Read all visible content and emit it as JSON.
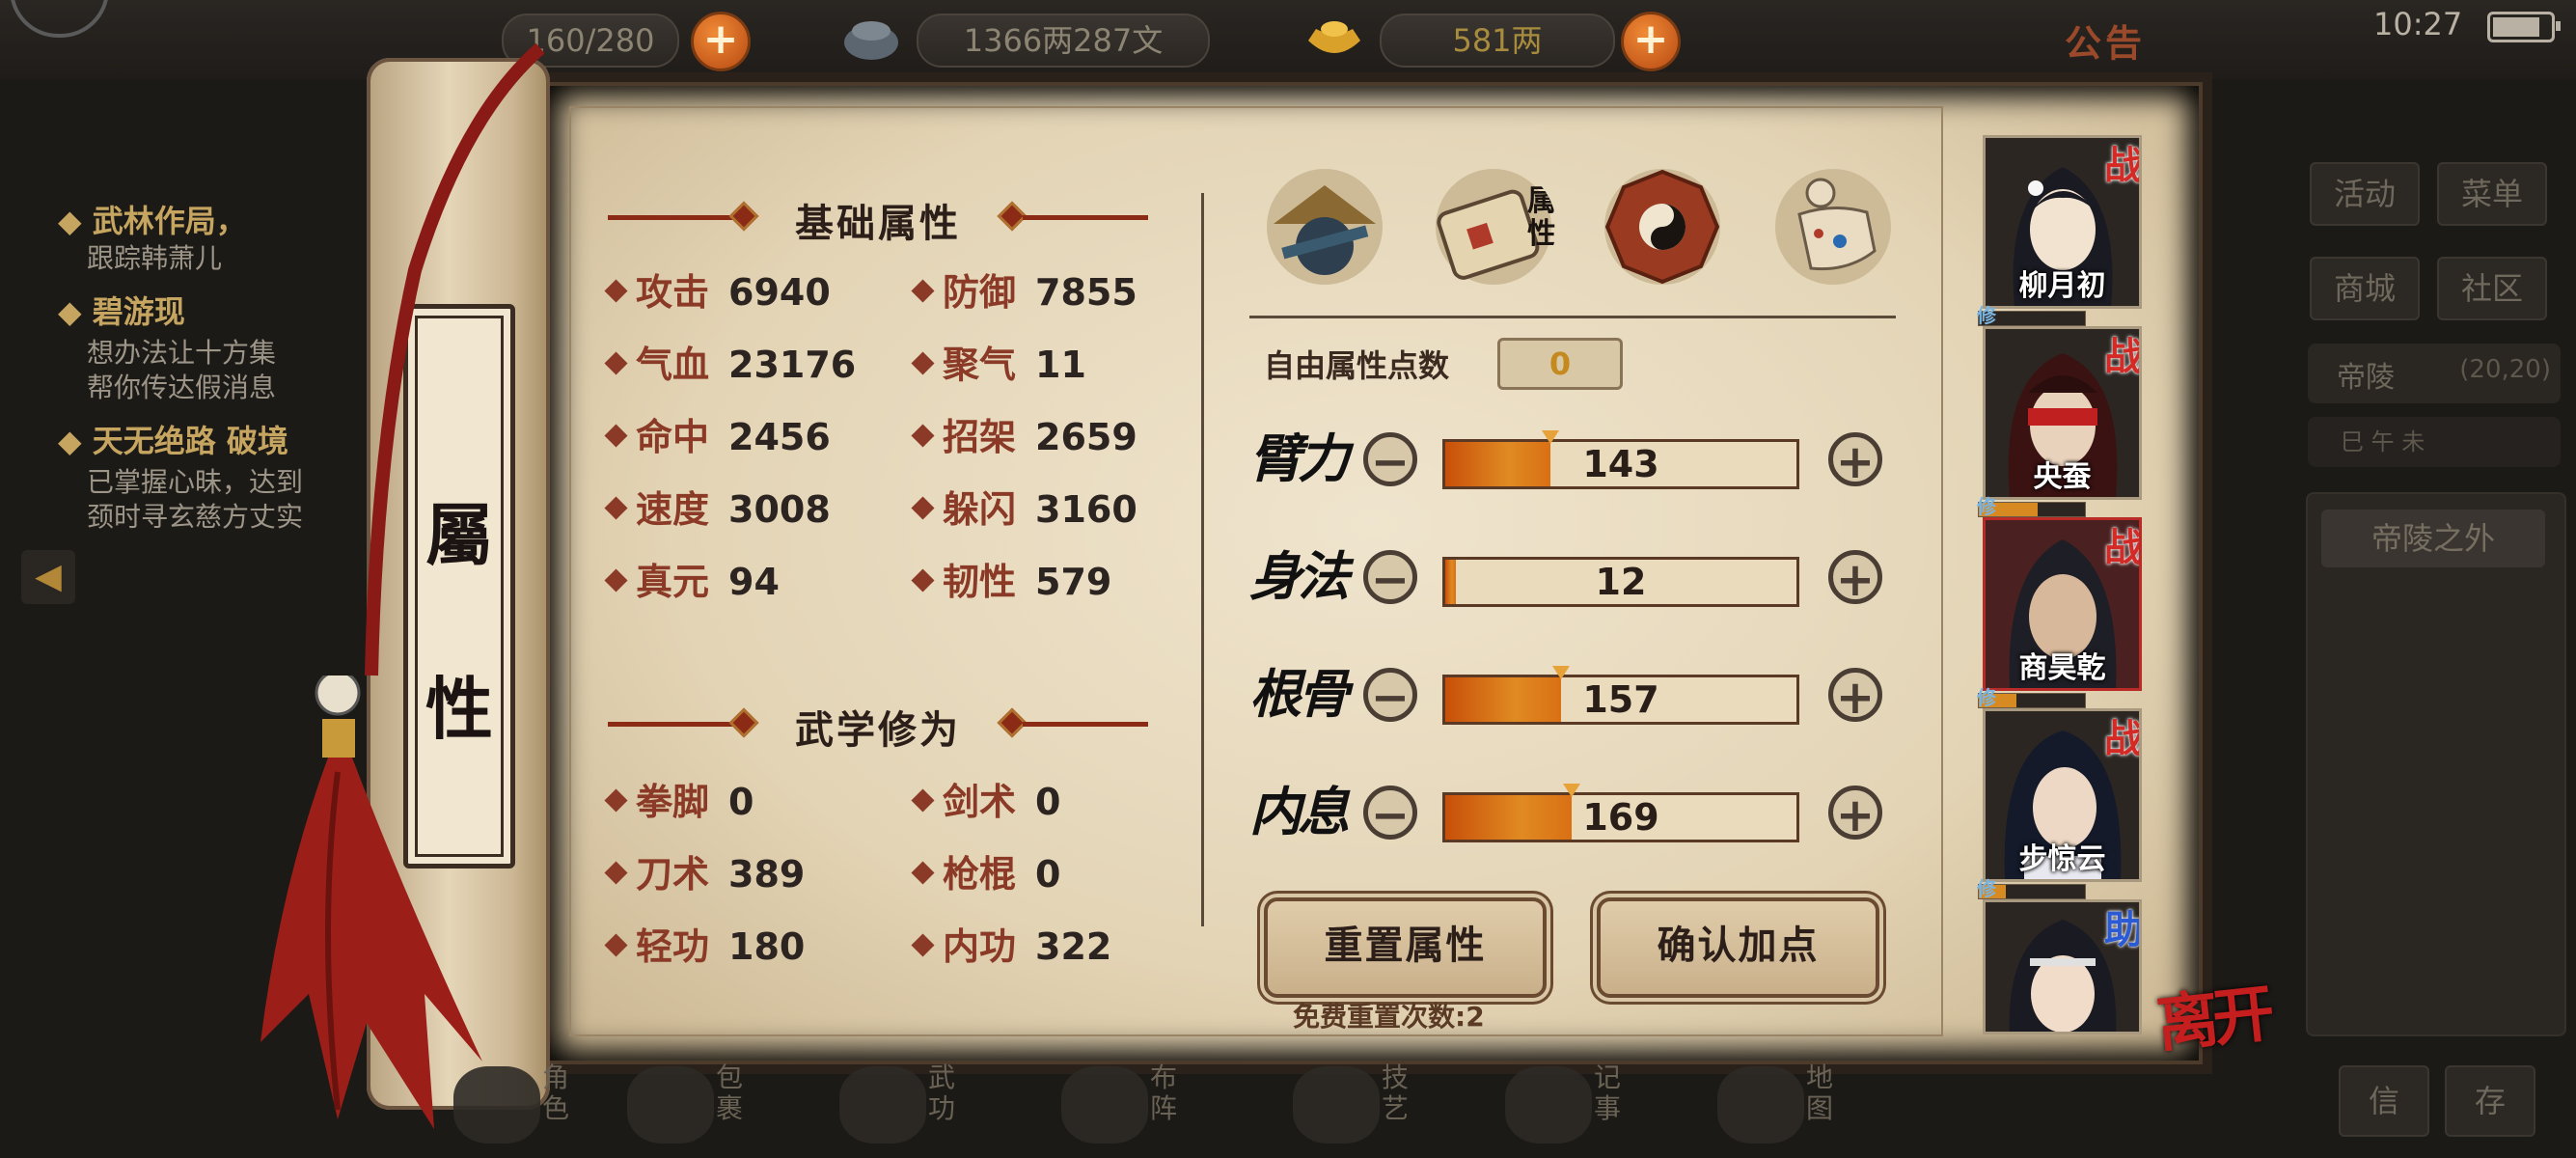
{
  "hud": {
    "stamina": "160/280",
    "money": "1366两287文",
    "gold": "581两",
    "notice": "公告",
    "time": "10:27",
    "battery_level": 0.85
  },
  "quests": [
    {
      "title": "武林作局，",
      "desc": "跟踪韩萧儿"
    },
    {
      "title": "碧游现",
      "desc": "想办法让十方集\n帮你传达假消息"
    },
    {
      "title": "天无绝路 破境",
      "desc": "已掌握心昧，达到\n颈时寻玄慈方丈实"
    }
  ],
  "scroll_tab": "屬\n性",
  "basic_section": "基础属性",
  "basic_stats": [
    {
      "label": "攻击",
      "value": "6940"
    },
    {
      "label": "防御",
      "value": "7855"
    },
    {
      "label": "气血",
      "value": "23176"
    },
    {
      "label": "聚气",
      "value": "11"
    },
    {
      "label": "命中",
      "value": "2456"
    },
    {
      "label": "招架",
      "value": "2659"
    },
    {
      "label": "速度",
      "value": "3008"
    },
    {
      "label": "躲闪",
      "value": "3160"
    },
    {
      "label": "真元",
      "value": "94"
    },
    {
      "label": "韧性",
      "value": "579"
    }
  ],
  "martial_section": "武学修为",
  "martial_stats": [
    {
      "label": "拳脚",
      "value": "0"
    },
    {
      "label": "剑术",
      "value": "0"
    },
    {
      "label": "刀术",
      "value": "389"
    },
    {
      "label": "枪棍",
      "value": "0"
    },
    {
      "label": "轻功",
      "value": "180"
    },
    {
      "label": "内功",
      "value": "322"
    }
  ],
  "tabs": {
    "selected_label": "属\n性"
  },
  "free_points": {
    "label": "自由属性点数",
    "value": "0"
  },
  "attributes": [
    {
      "name": "臂力",
      "value": "143",
      "fill": 0.3
    },
    {
      "name": "身法",
      "value": "12",
      "fill": 0.03
    },
    {
      "name": "根骨",
      "value": "157",
      "fill": 0.33
    },
    {
      "name": "内息",
      "value": "169",
      "fill": 0.36
    }
  ],
  "buttons": {
    "reset": "重置属性",
    "confirm": "确认加点",
    "minus": "−",
    "plus": "+"
  },
  "reset_count": "免费重置次数:2",
  "characters": [
    {
      "name": "柳月初",
      "badge": "战",
      "cult": 0.0
    },
    {
      "name": "央蚕",
      "badge": "战",
      "cult": 0.55
    },
    {
      "name": "商昊乾",
      "badge": "战",
      "cult": 0.35
    },
    {
      "name": "步惊云",
      "badge": "战",
      "cult": 0.25
    },
    {
      "name": "",
      "badge": "助",
      "cult": 0.0
    }
  ],
  "cult_tag": "修",
  "leave": "离开",
  "side_menu": {
    "activity": "活动",
    "menu": "菜单",
    "shop": "商城",
    "community": "社区",
    "location": "帝陵",
    "coords": "(20,20)",
    "time_row": "巳  午  未",
    "map_location": "帝陵之外",
    "btn_a": "信",
    "btn_b": "存"
  },
  "bottom_nav": [
    {
      "label": "角色"
    },
    {
      "label": "包裹"
    },
    {
      "label": "武功"
    },
    {
      "label": "布阵"
    },
    {
      "label": "技艺"
    },
    {
      "label": "记事"
    },
    {
      "label": "地图"
    }
  ],
  "colors": {
    "accent_red": "#8b2a15",
    "bar_orange": "#d97014",
    "badge_red": "#d42a26",
    "badge_blue": "#2a5ad4"
  }
}
